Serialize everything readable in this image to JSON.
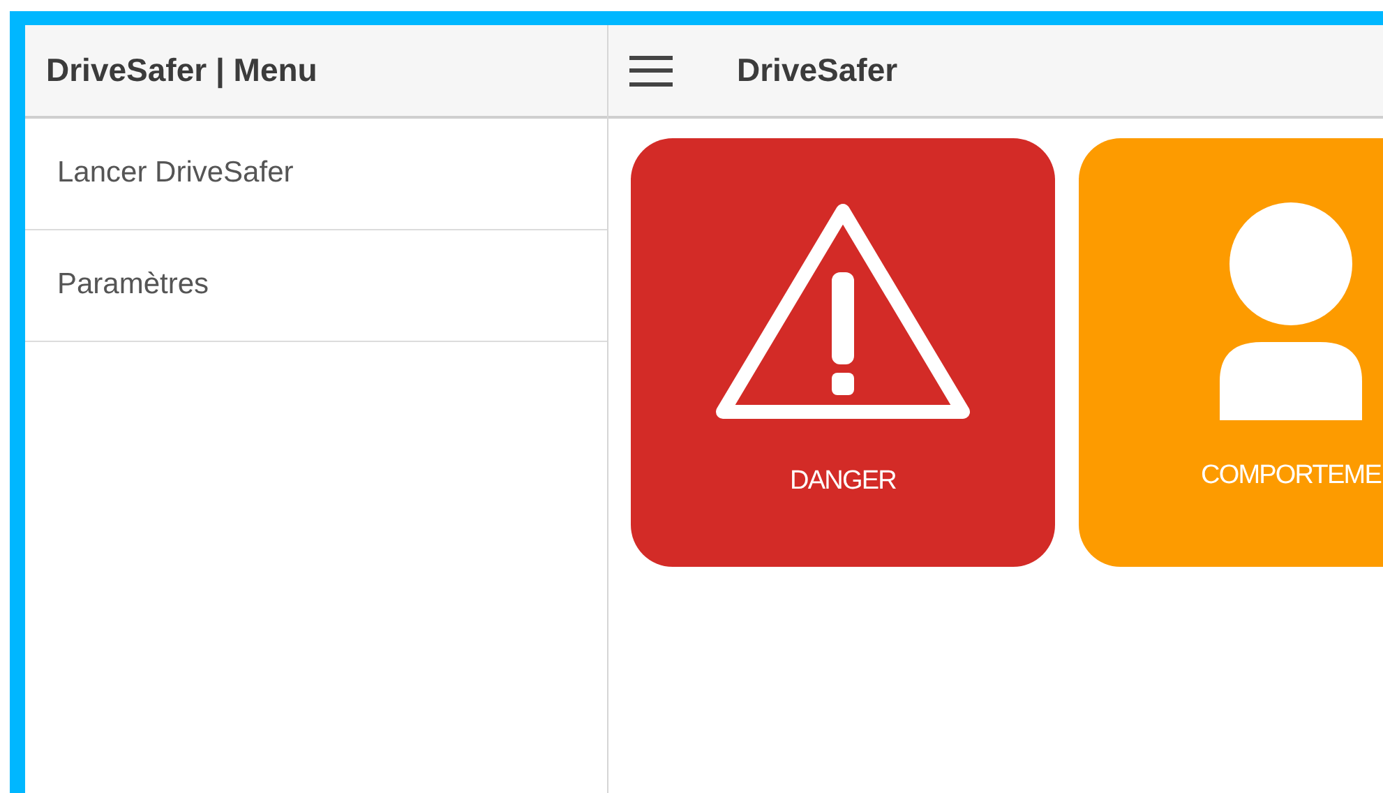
{
  "sidebar": {
    "title": "DriveSafer | Menu",
    "items": [
      {
        "label": "Lancer DriveSafer"
      },
      {
        "label": "Paramètres"
      }
    ]
  },
  "toolbar": {
    "title": "DriveSafer"
  },
  "tiles": [
    {
      "label": "DANGER",
      "kind": "danger",
      "color": "#d32b27"
    },
    {
      "label": "COMPORTEME",
      "kind": "person",
      "color": "#fd9b00"
    }
  ]
}
